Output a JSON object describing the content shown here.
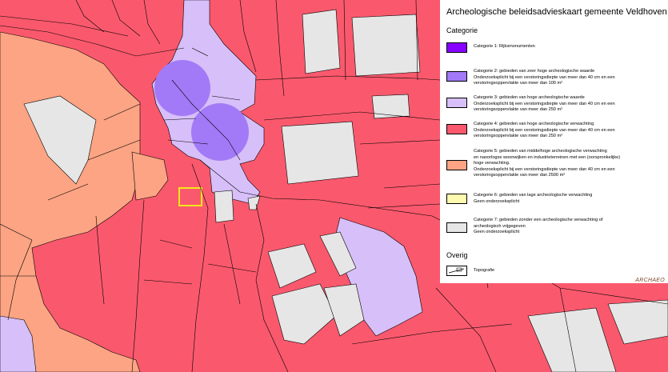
{
  "legend": {
    "title": "Archeologische beleidsadvieskaart gemeente Veldhoven",
    "category_heading": "Categorie",
    "other_heading": "Overig",
    "logo": "ARCHAEO",
    "categories": [
      {
        "color": "#8800ff",
        "lines": [
          "Categorie 1: Rijksmonumenten"
        ]
      },
      {
        "color": "#a27af7",
        "lines": [
          "Categorie 2: gebieden van zeer hoge archeologische waarde",
          "Onderzoeksplicht bij een verstoringsdiepte van meer dan 40 cm en een",
          "verstoringsoppervlakte van meer dan 100 m²"
        ]
      },
      {
        "color": "#d7bff9",
        "lines": [
          "Categorie 3: gebieden van hoge archeologische waarde",
          "Onderzoeksplicht bij een verstoringsdiepte van meer dan 40 cm en een",
          "verstoringsoppervlakte van meer dan 250 m²"
        ]
      },
      {
        "color": "#fa596d",
        "lines": [
          "Categorie 4: gebieden van hoge archeologische verwachting",
          "Onderzoeksplicht bij een verstoringsdiepte van meer dan 40 cm en een",
          "verstoringsoppervlakte van meer dan 250 m²"
        ]
      },
      {
        "color": "#fca483",
        "lines": [
          "Categorie 5: gebieden van middelhoge archeologische verwachting",
          "en naoorlogse woonwijken en industrieterreinen met een (oorspronkelijke)",
          "hoge verwachting.",
          "Onderzoeksplicht bij een verstoringsdiepte van meer dan 40 cm en een",
          "verstoringsoppervlakte van meer dan 2500 m²"
        ]
      },
      {
        "color": "#fefab0",
        "lines": [
          "Categorie 6: gebieden van lage archeologische verwachting",
          "Geen onderzoeksplicht"
        ]
      },
      {
        "color": "#e6e6e6",
        "lines": [
          "Categorie 7: gebieden zonder een archeologische verwachting of",
          "archeologisch vrijgegeven",
          "Geen onderzoeksplicht"
        ]
      }
    ],
    "other": [
      {
        "lines": [
          "Topografie"
        ]
      }
    ]
  }
}
